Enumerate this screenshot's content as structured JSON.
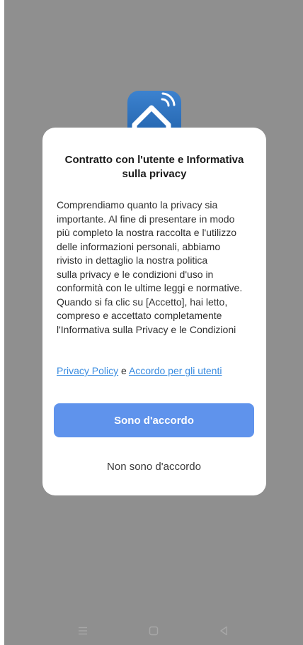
{
  "dialog": {
    "title": "Contratto con l'utente e Informativa sulla privacy",
    "body_lines": [
      "Comprendiamo quanto la privacy sia",
      "importante. Al fine di presentare in modo",
      "più completo la nostra raccolta e l'utilizzo",
      "delle informazioni personali, abbiamo",
      "rivisto in dettaglio la nostra politica",
      "sulla privacy e le condizioni d'uso in",
      "conformità con le ultime leggi e normative.",
      "Quando si fa clic su [Accetto], hai letto,",
      "compreso e accettato completamente",
      "l'Informativa sulla Privacy e le Condizioni"
    ],
    "privacy_link": "Privacy Policy",
    "links_separator": " e ",
    "user_agreement_link": "Accordo per gli utenti",
    "agree_label": "Sono d'accordo",
    "disagree_label": "Non sono d'accordo"
  },
  "app_icon": "smart-home-icon",
  "nav_bar": {
    "icons": [
      "menu-icon",
      "home-icon",
      "back-icon"
    ]
  },
  "colors": {
    "overlay_background": "#8f8f8f",
    "dialog_background": "#ffffff",
    "primary_button": "#5f93ec",
    "link": "#3a8ce0"
  }
}
